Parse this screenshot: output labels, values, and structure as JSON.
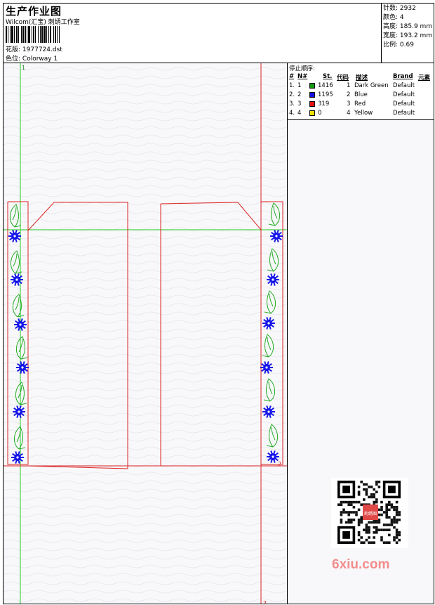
{
  "header": {
    "title": "生产作业图",
    "company": "Wilcom(汇宝) 刺绣工作室",
    "design_label": "花版:",
    "design_value": "1977724.dst",
    "colorway_label": "色位:",
    "colorway_value": "Colorway 1"
  },
  "stats": [
    {
      "label": "针数:",
      "value": "2932"
    },
    {
      "label": "颜色:",
      "value": "4"
    },
    {
      "label": "高度:",
      "value": "185.9 mm"
    },
    {
      "label": "宽度:",
      "value": "193.2 mm"
    },
    {
      "label": "比例:",
      "value": "0.69"
    }
  ],
  "stop_sequence": {
    "title": "停止顺序:",
    "columns": [
      "#",
      "N#",
      "St.",
      "代码",
      "描述",
      "Brand",
      "元素"
    ],
    "rows": [
      {
        "num": "1.",
        "n": "1",
        "color": "#119a11",
        "stitches": "1416",
        "code": "1",
        "desc": "Dark Green",
        "brand": "Default"
      },
      {
        "num": "2.",
        "n": "2",
        "color": "#1010e0",
        "stitches": "1195",
        "code": "2",
        "desc": "Blue",
        "brand": "Default"
      },
      {
        "num": "3.",
        "n": "3",
        "color": "#e81010",
        "stitches": "319",
        "code": "3",
        "desc": "Red",
        "brand": "Default"
      },
      {
        "num": "4.",
        "n": "4",
        "color": "#f0e000",
        "stitches": "0",
        "code": "4",
        "desc": "Yellow",
        "brand": "Default"
      }
    ]
  },
  "canvas_markers": {
    "green_top": "1",
    "red_mid": "2",
    "red_bottom": "2"
  },
  "watermark": "6xiu.com",
  "qr_stamp": "刺绣图"
}
